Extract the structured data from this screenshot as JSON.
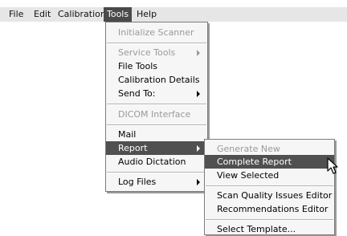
{
  "menubar": {
    "items": [
      "File",
      "Edit",
      "Calibration",
      "Tools",
      "Help"
    ],
    "active": "Tools"
  },
  "tools_menu": {
    "items": [
      {
        "label": "Initialize Scanner",
        "disabled": true
      },
      {
        "label": "Service Tools",
        "disabled": true,
        "submenu": true
      },
      {
        "label": "File Tools"
      },
      {
        "label": "Calibration Details"
      },
      {
        "label": "Send To:",
        "submenu": true
      },
      {
        "label": "DICOM Interface",
        "disabled": true
      },
      {
        "label": "Mail"
      },
      {
        "label": "Report",
        "submenu": true,
        "highlighted": true
      },
      {
        "label": "Audio Dictation"
      },
      {
        "label": "Log Files",
        "submenu": true
      }
    ]
  },
  "report_submenu": {
    "items": [
      {
        "label": "Generate New",
        "disabled": true
      },
      {
        "label": "Complete Report",
        "highlighted": true
      },
      {
        "label": "View Selected"
      },
      {
        "label": "Scan Quality Issues Editor"
      },
      {
        "label": "Recommendations Editor"
      },
      {
        "label": "Select Template..."
      }
    ]
  },
  "icons": {
    "submenu_arrow": "triangle-right-icon",
    "cursor": "mouse-pointer-icon"
  },
  "colors": {
    "menubar_bg": "#e6e6e6",
    "highlight_bg": "#505050",
    "menu_bg": "#f6f6f6",
    "disabled_text": "#9a9a9a"
  }
}
